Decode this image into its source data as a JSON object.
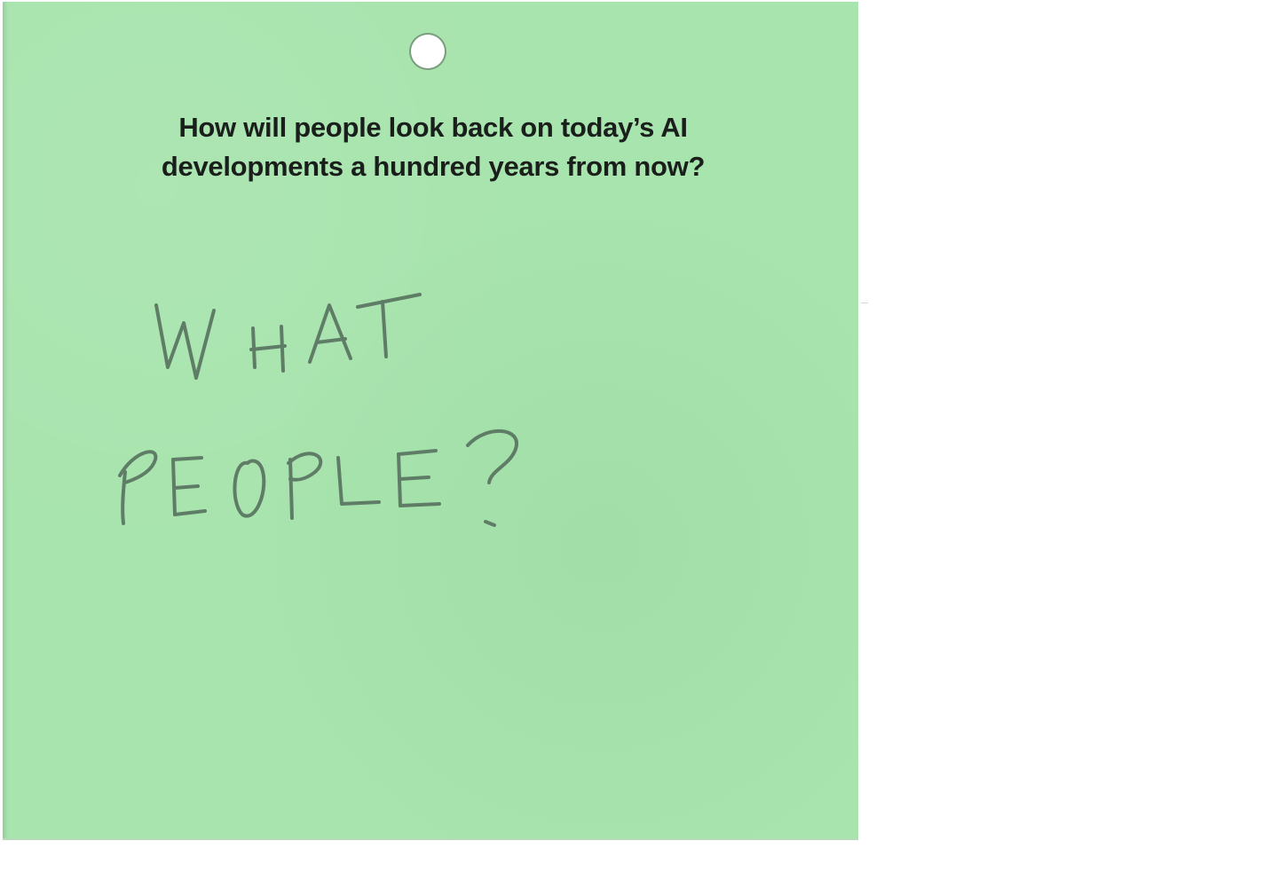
{
  "card": {
    "question": "How will people look back on today’s AI developments a hundred years from now?",
    "answer_line_1": "WHAT",
    "answer_line_2": "PEOPLE?",
    "background_color": "#a8e4ae",
    "ink_color": "#5f7d66"
  }
}
